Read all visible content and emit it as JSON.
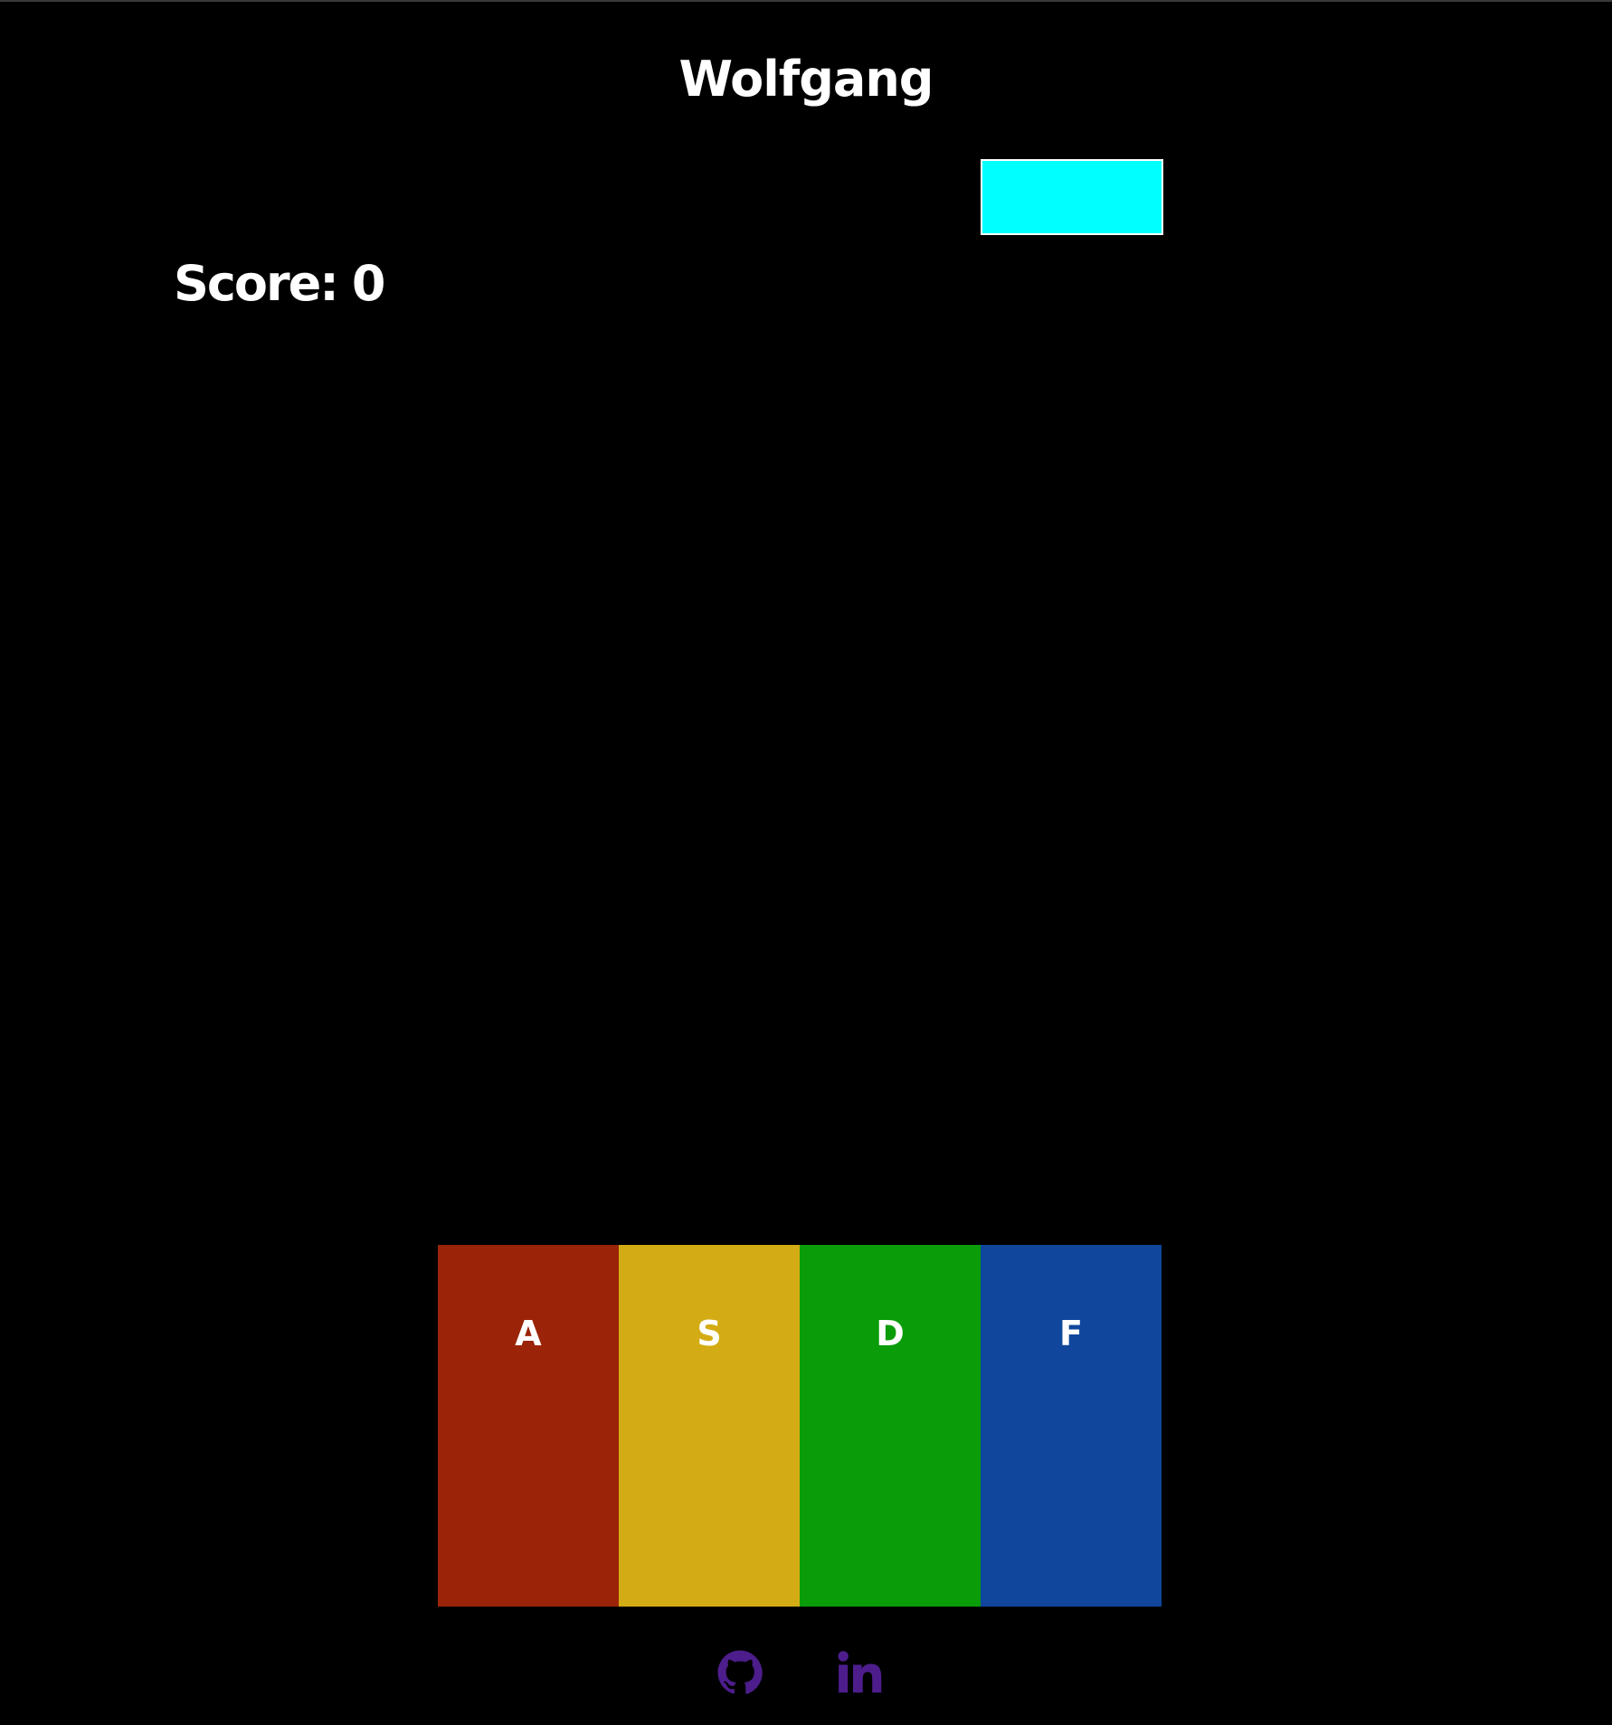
{
  "game": {
    "title": "Wolfgang",
    "score_label": "Score:",
    "score_value": "0"
  },
  "falling_note": {
    "color": "#00ffff"
  },
  "keys": [
    {
      "label": "A",
      "color": "#9b2408"
    },
    {
      "label": "S",
      "color": "#d3ab14"
    },
    {
      "label": "D",
      "color": "#0a9c09"
    },
    {
      "label": "F",
      "color": "#10479c"
    }
  ],
  "footer": {
    "icon_color": "#4d1d8c",
    "links": [
      {
        "icon": "github-icon"
      },
      {
        "icon": "linkedin-icon"
      }
    ]
  }
}
